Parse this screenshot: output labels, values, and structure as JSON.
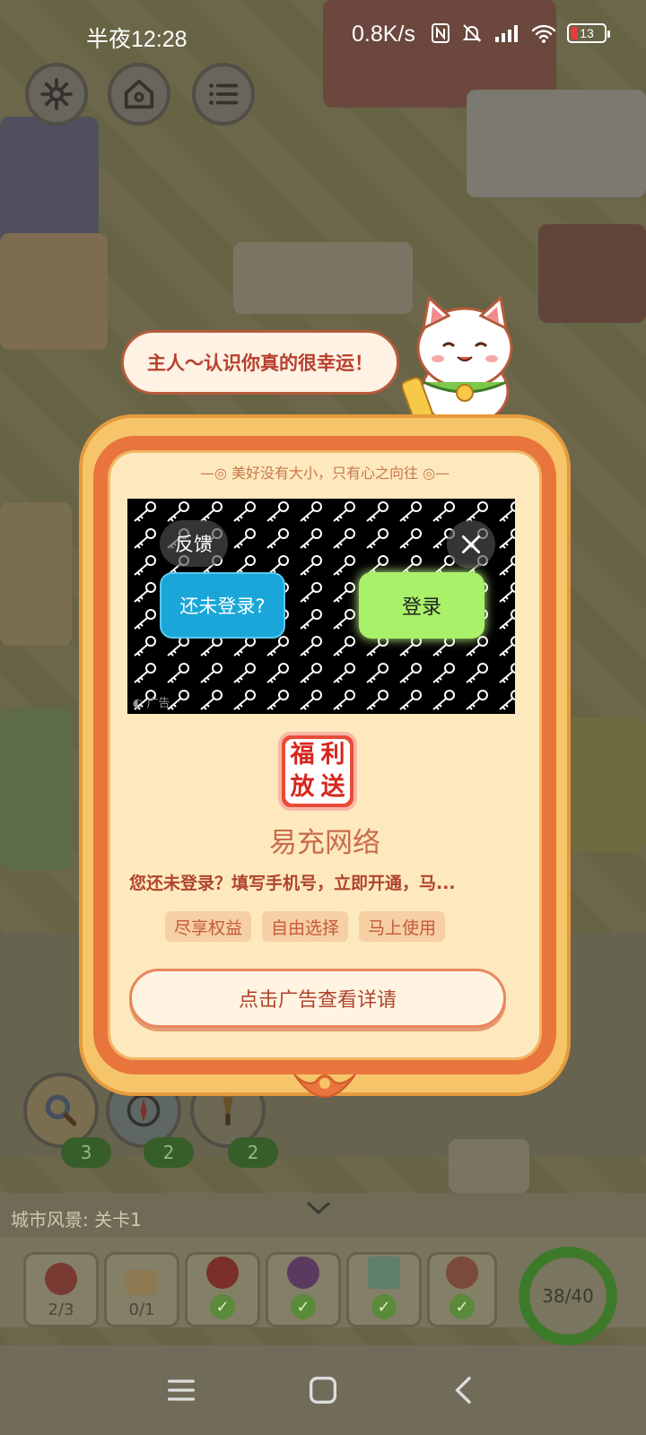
{
  "status_bar": {
    "time": "半夜12:28",
    "speed": "0.8K/s",
    "battery": "13"
  },
  "speech_bubble": "主人～认识你真的很幸运！",
  "dialog": {
    "motto": "美好没有大小，只有心之向往",
    "ad": {
      "feedback_label": "反馈",
      "left_button": "还未登录?",
      "right_button": "登录",
      "ad_label": "广告"
    },
    "app_icon_text": [
      "福",
      "利",
      "放",
      "送"
    ],
    "app_name": "易充网络",
    "description": "您还未登录？填写手机号，立即开通，马...",
    "tags": [
      "尽享权益",
      "自由选择",
      "马上使用"
    ],
    "cta": "点击广告查看详请"
  },
  "game": {
    "level_label": "城市风景: 关卡1",
    "badges": [
      "3",
      "2",
      "2"
    ],
    "items": [
      {
        "icon": "strawberry-icon",
        "count": "2/3"
      },
      {
        "icon": "envelope-icon",
        "count": "0/1"
      },
      {
        "icon": "ladybug-icon",
        "done": true
      },
      {
        "icon": "eggplant-icon",
        "done": true
      },
      {
        "icon": "milk-box-icon",
        "done": true
      },
      {
        "icon": "meat-icon",
        "done": true
      }
    ],
    "progress": "38/40"
  }
}
